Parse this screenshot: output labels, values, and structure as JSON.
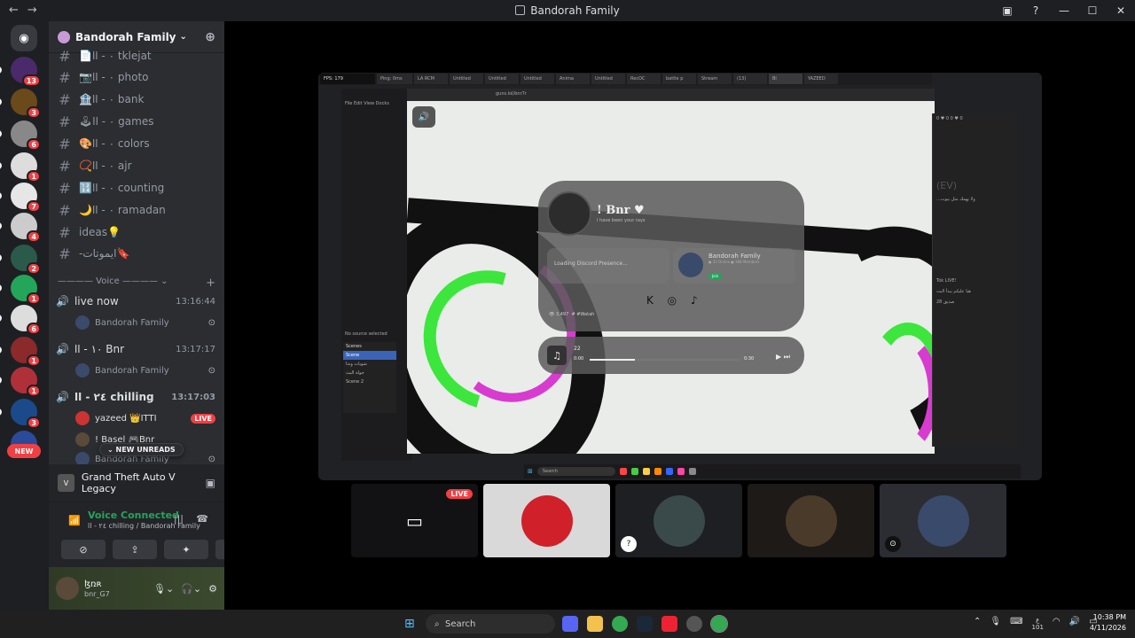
{
  "window": {
    "title": "Bandorah Family",
    "back_icon": "←",
    "forward_icon": "→"
  },
  "servers": {
    "badges": [
      "13",
      "3",
      "6",
      "1",
      "7",
      "4",
      "2",
      "1",
      "6",
      "1",
      "1",
      "3"
    ],
    "new_label": "NEW"
  },
  "server": {
    "name": "Bandorah Family"
  },
  "channels": [
    {
      "label": "tklejat",
      "prefix": "📄٠ - اا"
    },
    {
      "label": "photo",
      "prefix": "📷٠ - اا"
    },
    {
      "label": "bank",
      "prefix": "🏦٠ - اا"
    },
    {
      "label": "games",
      "prefix": "🕹٠ - اا"
    },
    {
      "label": "colors",
      "prefix": "🎨٠ - اا"
    },
    {
      "label": "ajr",
      "prefix": "📿٠ - اا"
    },
    {
      "label": "counting",
      "prefix": "🔢٠ - اا"
    },
    {
      "label": "ramadan",
      "prefix": "🌙٠ - اا"
    },
    {
      "label": "ideas💡",
      "prefix": ""
    },
    {
      "label": "-ايموتات🔖",
      "prefix": ""
    }
  ],
  "voice": {
    "category": "———— Voice ————",
    "channels": [
      {
        "name": "live now",
        "time": "13:16:44",
        "users": [
          {
            "name": "Bandorah Family",
            "live": ""
          }
        ]
      },
      {
        "name": "١٠ - اا Bnr",
        "time": "13:17:17",
        "users": [
          {
            "name": "Bandorah Family",
            "live": ""
          }
        ]
      },
      {
        "name": "٢٤ - اا chilling",
        "time": "13:17:03",
        "users": [
          {
            "name": "yazeed 👑ITTI",
            "live": "LIVE"
          },
          {
            "name": "! Basel 🎮Bnr",
            "live": ""
          },
          {
            "name": "Bandorah Family",
            "live": ""
          }
        ]
      }
    ],
    "new_unreads": "NEW UNREADS"
  },
  "activity": {
    "game": "Grand Theft Auto V Legacy",
    "gta_icon": "gta-v-icon"
  },
  "voice_connected": {
    "status": "Voice Connected",
    "location": "٢٤ - اا chilling / Bandorah Family"
  },
  "user": {
    "display": "ɮռʀ",
    "tag": "bnr_G7"
  },
  "stream": {
    "fps": "FPS: 179",
    "ping": "Ping: 0ms",
    "tabs": [
      "LA RCM",
      "Untitled",
      "Untitled",
      "Untitled",
      "Anima",
      "Untitled",
      "RecOC",
      "battle p",
      "Stream",
      "(13)",
      "Bl",
      "YAZEED"
    ],
    "obs_menu": "File  Edit  View  Docks",
    "scenes_title": "Scenes",
    "scenes": [
      "Scene",
      "شوبات وندا",
      "جولة البث",
      "Scene 2"
    ],
    "no_source": "No source selected",
    "url": "guns.lol/bnr7r",
    "profile": {
      "name": "! Bnr ♥",
      "desc": "I have been your rays",
      "discord_loading": "Loading Discord Presence...",
      "guild_name": "Bandorah Family",
      "guild_stats": "● 33 Online  ● 388 Members",
      "join": "Join",
      "views": "👁 3,497",
      "tag": "# #Watah"
    },
    "music": {
      "track": "22",
      "time_start": "0:00",
      "time_end": "0:30"
    },
    "right_panel": [
      "0 ♥ 0  0 ♥ 0",
      "(EV)",
      "...ولا يهمك مثل بيوت",
      "Tok LIVE!",
      "هيا عليكم يبدأ البث",
      "28 صديق"
    ],
    "taskbar_search": "Search"
  },
  "tiles": [
    {
      "type": "screen",
      "live": "LIVE"
    },
    {
      "type": "art",
      "live": ""
    },
    {
      "type": "avatar",
      "live": ""
    },
    {
      "type": "avatar",
      "live": ""
    },
    {
      "type": "avatar",
      "live": ""
    }
  ],
  "taskbar": {
    "search": "Search",
    "lang_top": "ع",
    "lang_bottom": "101",
    "time": "10:38 PM",
    "date": "4/11/2026"
  }
}
